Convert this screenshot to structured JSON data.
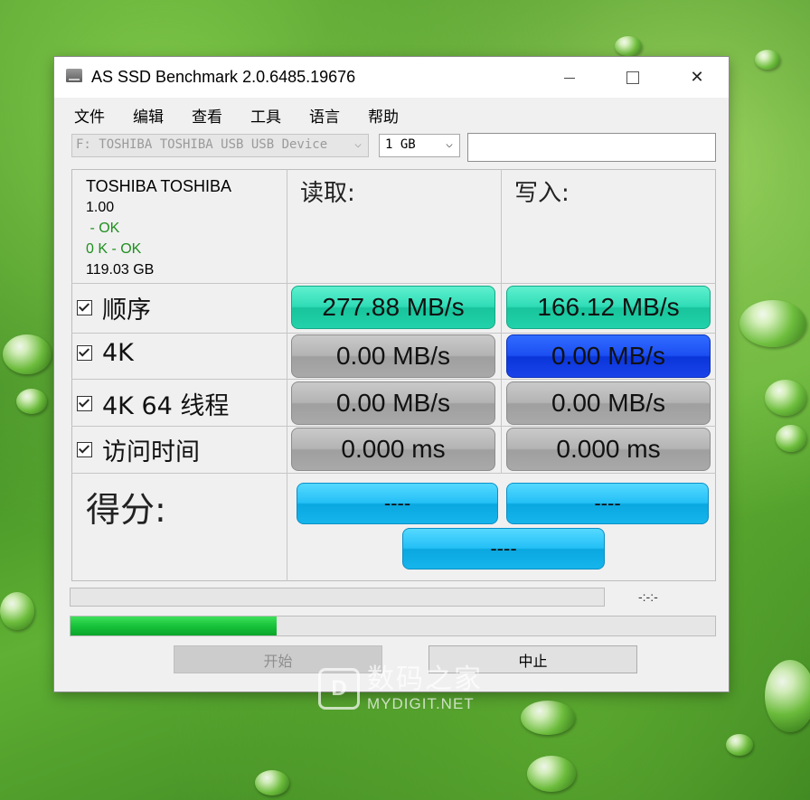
{
  "window": {
    "title": "AS SSD Benchmark 2.0.6485.19676",
    "minimize": "",
    "close": "✕"
  },
  "menu": [
    "文件",
    "编辑",
    "查看",
    "工具",
    "语言",
    "帮助"
  ],
  "drive_select": {
    "value": "F: TOSHIBA TOSHIBA USB USB Device",
    "chevron": "⌵"
  },
  "size_select": {
    "value": "1 GB",
    "chevron": "⌵"
  },
  "device_info": {
    "name": "TOSHIBA TOSHIBA",
    "version": "1.00",
    "status1": " - OK",
    "status2": "0 K - OK",
    "capacity": "119.03 GB"
  },
  "headers": {
    "read": "读取:",
    "write": "写入:"
  },
  "rows": [
    {
      "label": "顺序",
      "checked": true,
      "read": "277.88 MB/s",
      "write": "166.12 MB/s"
    },
    {
      "label": "4K",
      "checked": true,
      "read": "0.00 MB/s",
      "write": "0.00 MB/s"
    },
    {
      "label": "4K 64 线程",
      "checked": true,
      "read": "0.00 MB/s",
      "write": "0.00 MB/s"
    },
    {
      "label": "访问时间",
      "checked": true,
      "read": "0.000 ms",
      "write": "0.000 ms"
    }
  ],
  "score": {
    "label": "得分:",
    "read": "----",
    "write": "----",
    "total": "----"
  },
  "progress": {
    "timer": "-:-:-",
    "fill_fraction": 0.32
  },
  "buttons": {
    "start": "开始",
    "stop": "中止"
  },
  "watermark": {
    "logo": "D",
    "cn": "数码之家",
    "en": "MYDIGIT.NET"
  },
  "colors": {
    "sequential": "#2fdcb6",
    "active": "#1d4ff2",
    "idle": "#b4b4b4",
    "score": "#24c0f6",
    "progress": "#18c23a"
  }
}
